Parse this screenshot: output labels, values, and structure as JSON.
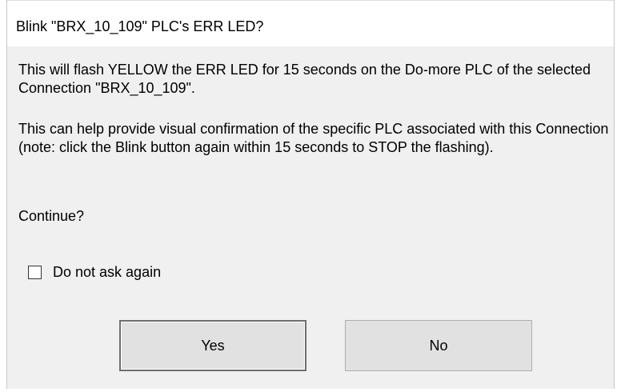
{
  "dialog": {
    "title": "Blink \"BRX_10_109\" PLC's ERR LED?",
    "message_1": "This will flash YELLOW the ERR LED for 15 seconds on the Do-more PLC of the selected Connection \"BRX_10_109\".",
    "message_2": "This can help provide visual confirmation of the specific PLC associated with this Connection (note: click the Blink button again within 15 seconds to STOP the flashing).",
    "message_3": "Continue?",
    "checkbox": {
      "label": "Do not ask again",
      "checked": false
    },
    "buttons": {
      "yes_label": "Yes",
      "no_label": "No"
    }
  }
}
